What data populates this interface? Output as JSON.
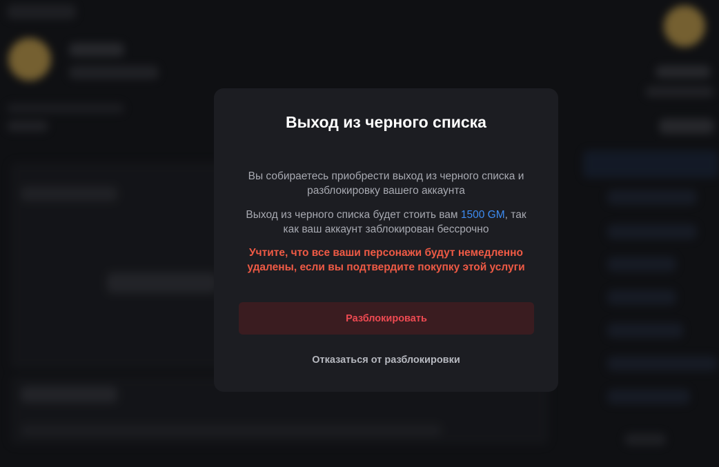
{
  "modal": {
    "title": "Выход из черного списка",
    "paragraph1": "Вы собираетесь приобрести выход из черного списка и разблокировку вашего аккаунта",
    "paragraph2_before": "Выход из черного списка будет стоить вам ",
    "paragraph2_price": "1500 GM",
    "paragraph2_after": ", так как ваш аккаунт заблокирован бессрочно",
    "warning": "Учтите, что все ваши персонажи будут немедленно удалены, если вы подтвердите покупку этой услуги",
    "confirm_label": "Разблокировать",
    "cancel_label": "Отказаться от разблокировки"
  },
  "colors": {
    "price": "#3d8cf2",
    "warning": "#ef5a45",
    "confirm_text": "#ef4a52",
    "confirm_bg": "#3a1c20"
  }
}
